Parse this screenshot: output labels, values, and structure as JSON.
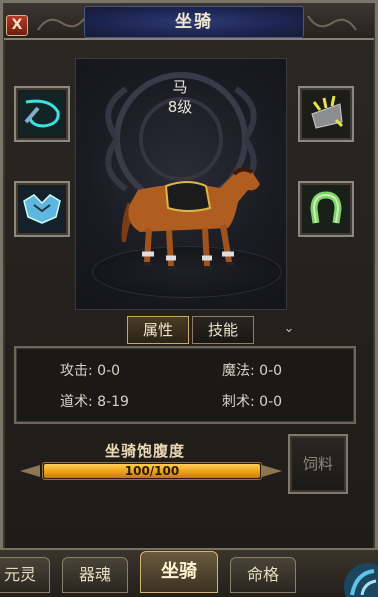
{
  "window": {
    "title": "坐骑",
    "close_label": "X"
  },
  "mount": {
    "name": "马",
    "level": "8级"
  },
  "equipment_slots": [
    {
      "name": "whip",
      "icon": "whip-icon"
    },
    {
      "name": "armor",
      "icon": "horse-armor-icon"
    },
    {
      "name": "bridle",
      "icon": "spiked-bridle-icon"
    },
    {
      "name": "horseshoe",
      "icon": "horseshoe-icon"
    }
  ],
  "tabs": [
    {
      "label": "属性",
      "active": true
    },
    {
      "label": "技能",
      "active": false
    }
  ],
  "attributes": {
    "attack": "攻击: 0-0",
    "magic": "魔法: 0-0",
    "taoism": "道术: 8-19",
    "assassination": "刺术: 0-0"
  },
  "satiety": {
    "label": "坐骑饱腹度",
    "current": 100,
    "max": 100,
    "text": "100/100"
  },
  "feed_button": {
    "label": "饲料"
  },
  "bottom_tabs": [
    {
      "label": "元灵",
      "active": false
    },
    {
      "label": "器魂",
      "active": false
    },
    {
      "label": "坐骑",
      "active": true
    },
    {
      "label": "命格",
      "active": false
    }
  ],
  "colors": {
    "title_bg": "#1c2450",
    "bar_fill": "#f0a519",
    "frame": "#8e877b"
  }
}
